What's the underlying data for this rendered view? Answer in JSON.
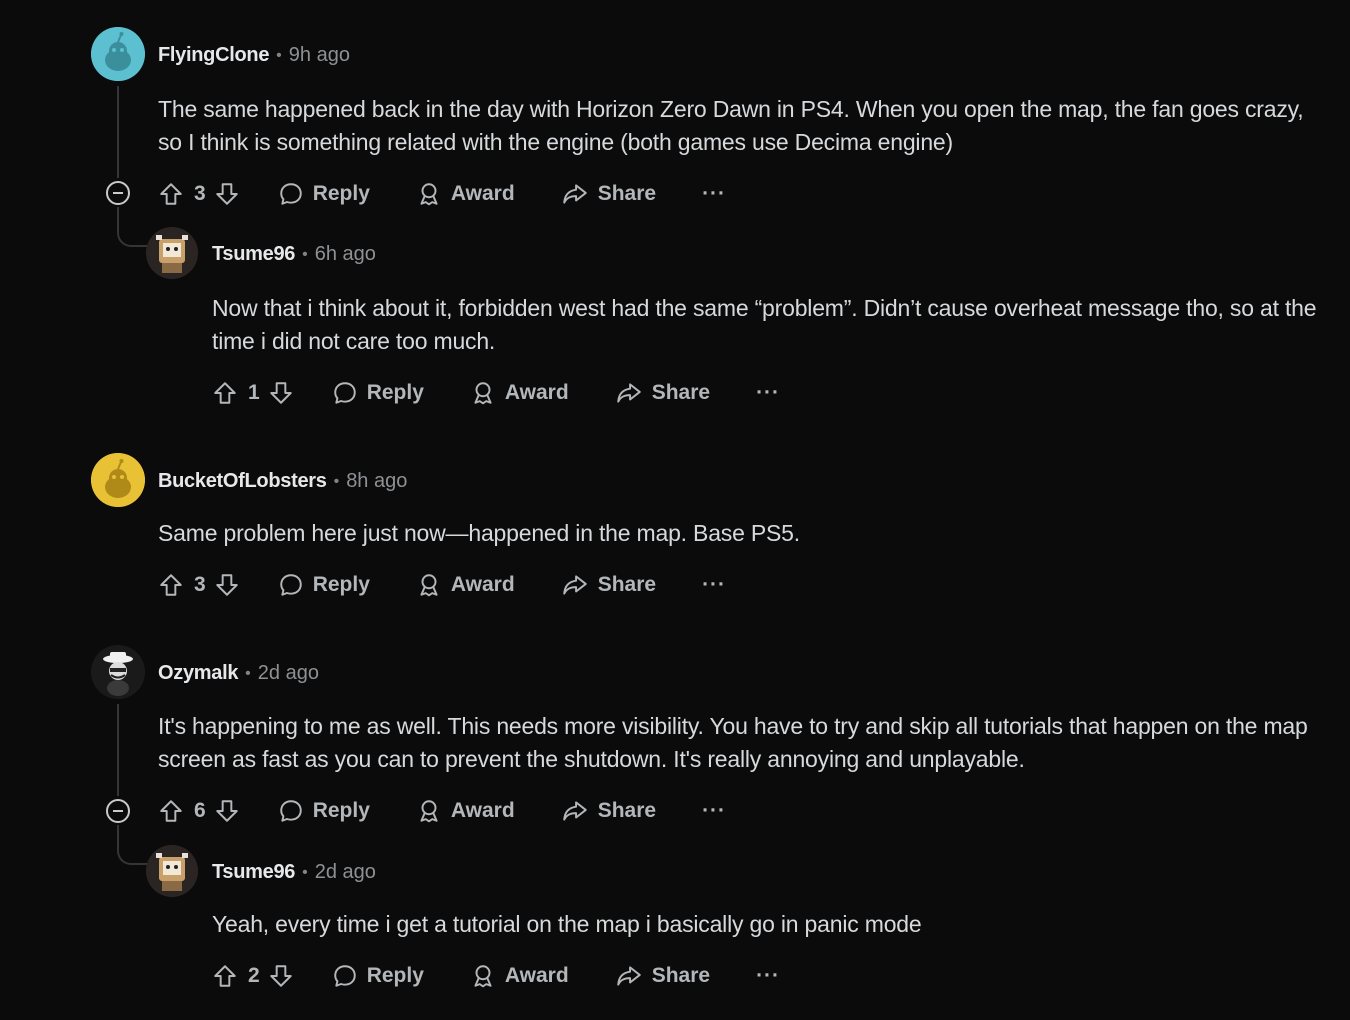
{
  "comments": [
    {
      "username": "FlyingClone",
      "separator": "•",
      "time": "9h ago",
      "body": "The same happened back in the day with Horizon Zero Dawn in PS4. When you open the map, the fan goes crazy, so I think is something related with the engine (both games use Decima engine)",
      "votes": "3",
      "avatar_color": "#5cc0d0",
      "replies": [
        {
          "username": "Tsume96",
          "separator": "•",
          "time": "6h ago",
          "body": "Now that i think about it, forbidden west had the same “problem”. Didn’t cause overheat message tho, so at the time i did not care too much.",
          "votes": "1"
        }
      ]
    },
    {
      "username": "BucketOfLobsters",
      "separator": "•",
      "time": "8h ago",
      "body": "Same problem here just now—happened in the map. Base PS5.",
      "votes": "3",
      "avatar_color": "#e8c234"
    },
    {
      "username": "Ozymalk",
      "separator": "•",
      "time": "2d ago",
      "body": "It's happening to me as well. This needs more visibility. You have to try and skip all tutorials that happen on the map screen as fast as you can to prevent the shutdown. It's really annoying and unplayable.",
      "votes": "6",
      "replies": [
        {
          "username": "Tsume96",
          "separator": "•",
          "time": "2d ago",
          "body": "Yeah, every time i get a tutorial on the map i basically go in panic mode",
          "votes": "2"
        }
      ]
    }
  ],
  "actions": {
    "reply": "Reply",
    "award": "Award",
    "share": "Share",
    "more": "···"
  },
  "icons": {
    "upvote": "upvote-icon",
    "downvote": "downvote-icon",
    "reply": "reply-bubble-icon",
    "award": "award-icon",
    "share": "share-icon",
    "more": "more-options-icon",
    "collapse": "collapse-thread-icon"
  },
  "colors": {
    "background": "#0b0b0c",
    "text": "#d7dadc",
    "muted": "#8e9193",
    "thread_line": "#343536"
  }
}
